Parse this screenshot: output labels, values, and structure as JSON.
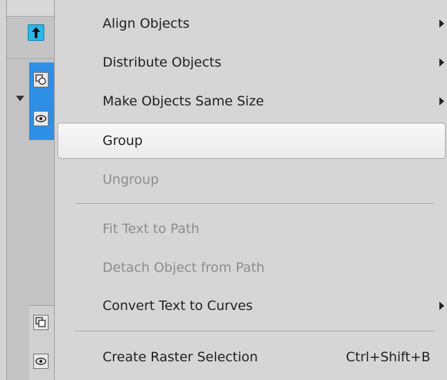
{
  "menu": {
    "items": [
      {
        "label": "Align Objects",
        "submenu": true,
        "enabled": true
      },
      {
        "label": "Distribute Objects",
        "submenu": true,
        "enabled": true
      },
      {
        "label": "Make Objects Same Size",
        "submenu": true,
        "enabled": true
      },
      {
        "label": "Group",
        "submenu": false,
        "enabled": true,
        "highlighted": true
      },
      {
        "label": "Ungroup",
        "submenu": false,
        "enabled": false
      },
      {
        "label": "Fit Text to Path",
        "submenu": false,
        "enabled": false
      },
      {
        "label": "Detach Object from Path",
        "submenu": false,
        "enabled": false
      },
      {
        "label": "Convert Text to Curves",
        "submenu": true,
        "enabled": true
      },
      {
        "label": "Create Raster Selection",
        "shortcut": "Ctrl+Shift+B",
        "submenu": false,
        "enabled": true
      }
    ]
  },
  "icons": {
    "submenu_arrow": "triangle-right-icon",
    "move_up": "arrow-up-icon",
    "object": "object-shapes-icon",
    "visibility": "eye-icon",
    "expand": "triangle-down-icon"
  },
  "colors": {
    "menu_bg": "#d6d6d6",
    "highlight_bg": "#f2f2f2",
    "disabled_text": "#8c8c8c",
    "selected_layer": "#2f8fe6",
    "up_button": "#29b6e8"
  }
}
